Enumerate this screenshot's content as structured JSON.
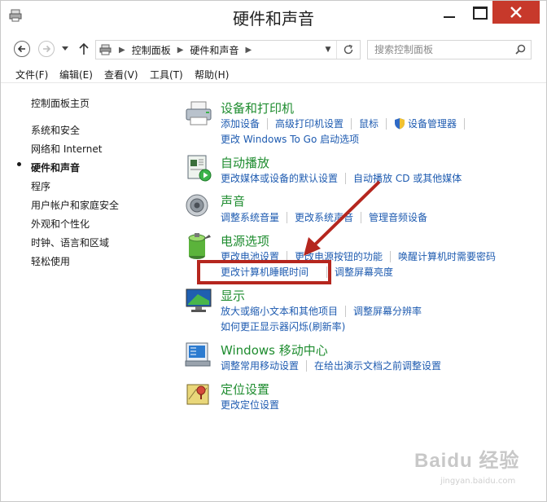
{
  "window": {
    "title": "硬件和声音"
  },
  "address_bar": {
    "crumbs": [
      "控制面板",
      "硬件和声音"
    ]
  },
  "search": {
    "placeholder": "搜索控制面板"
  },
  "menu": [
    "文件(F)",
    "编辑(E)",
    "查看(V)",
    "工具(T)",
    "帮助(H)"
  ],
  "sidebar": {
    "items": [
      "控制面板主页",
      "系统和安全",
      "网络和 Internet",
      "硬件和声音",
      "程序",
      "用户帐户和家庭安全",
      "外观和个性化",
      "时钟、语言和区域",
      "轻松使用"
    ],
    "active": "硬件和声音"
  },
  "categories": [
    {
      "title": "设备和打印机",
      "icon": "printer-icon",
      "rows": [
        [
          "添加设备",
          "高级打印机设置",
          "鼠标",
          "设备管理器"
        ],
        [
          "更改 Windows To Go 启动选项"
        ]
      ]
    },
    {
      "title": "自动播放",
      "icon": "autoplay-icon",
      "rows": [
        [
          "更改媒体或设备的默认设置",
          "自动播放 CD 或其他媒体"
        ]
      ]
    },
    {
      "title": "声音",
      "icon": "speaker-icon",
      "rows": [
        [
          "调整系统音量",
          "更改系统声音",
          "管理音频设备"
        ]
      ]
    },
    {
      "title": "电源选项",
      "icon": "battery-icon",
      "rows": [
        [
          "更改电池设置",
          "更改电源按钮的功能",
          "唤醒计算机时需要密码"
        ],
        [
          "更改计算机睡眠时间",
          "调整屏幕亮度"
        ]
      ]
    },
    {
      "title": "显示",
      "icon": "display-icon",
      "rows": [
        [
          "放大或缩小文本和其他项目",
          "调整屏幕分辨率"
        ],
        [
          "如何更正显示器闪烁(刷新率)"
        ]
      ]
    },
    {
      "title": "Windows 移动中心",
      "icon": "mobility-center-icon",
      "rows": [
        [
          "调整常用移动设置",
          "在给出演示文档之前调整设置"
        ]
      ]
    },
    {
      "title": "定位设置",
      "icon": "location-icon",
      "rows": [
        [
          "更改定位设置"
        ]
      ]
    }
  ],
  "watermark": {
    "text": "Baidu 经验",
    "url": "jingyan.baidu.com"
  },
  "colors": {
    "category_title": "#1e8c2f",
    "link": "#1e5bb0",
    "close_button": "#c7392b",
    "annotation": "#b5261e"
  }
}
